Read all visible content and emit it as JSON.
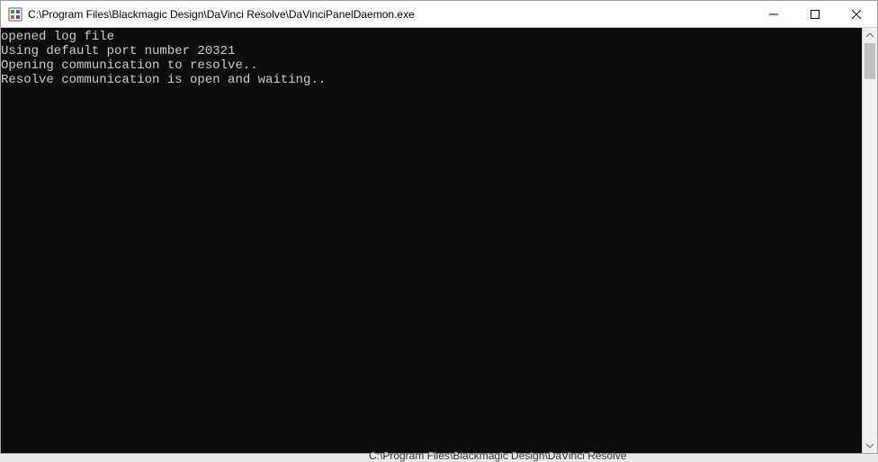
{
  "window": {
    "title": "C:\\Program Files\\Blackmagic Design\\DaVinci Resolve\\DaVinciPanelDaemon.exe"
  },
  "console": {
    "lines": [
      "opened log file",
      "Using default port number 20321",
      "Opening communication to resolve..",
      "Resolve communication is open and waiting.."
    ]
  },
  "taskbar": {
    "fragment": "C:\\Program Files\\Blackmagic Design\\DaVinci Resolve"
  }
}
